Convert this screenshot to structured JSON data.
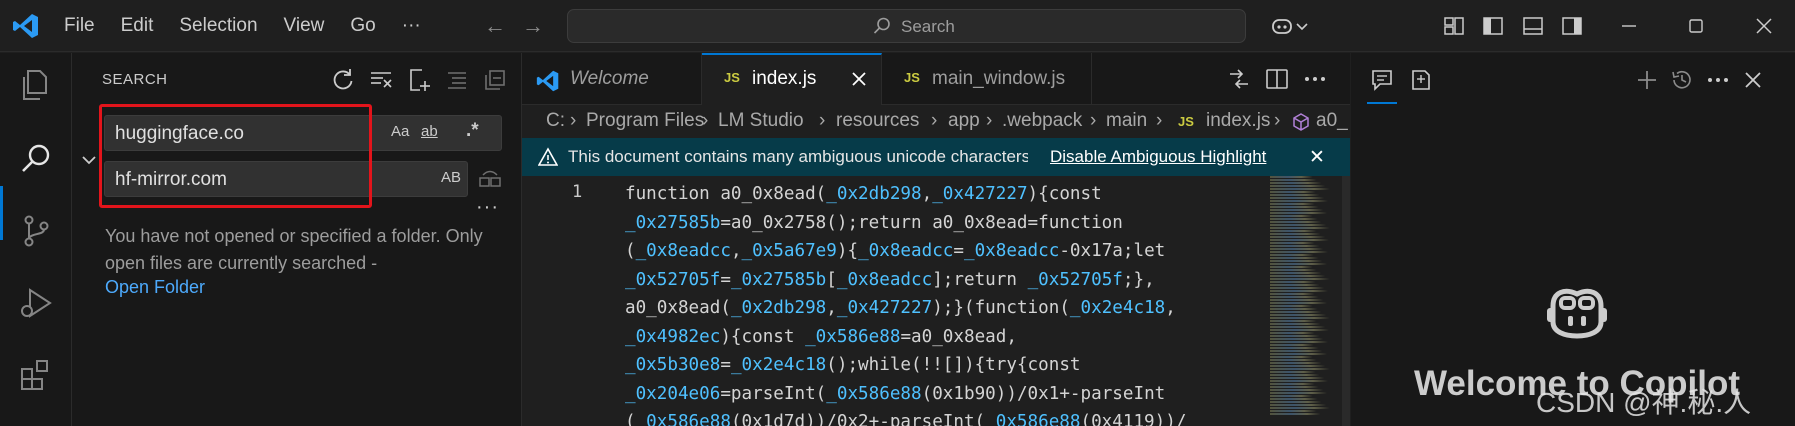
{
  "titlebar": {
    "menu": [
      "File",
      "Edit",
      "Selection",
      "View",
      "Go",
      "···"
    ],
    "search_placeholder": "Search"
  },
  "search_panel": {
    "title": "SEARCH",
    "search_value": "huggingface.co",
    "replace_value": "hf-mirror.com",
    "match_case": "Aa",
    "whole_word": "ab",
    "regex": ".*",
    "preserve_case": "AB",
    "more": "···",
    "message": "You have not opened or specified a folder. Only open files are currently searched -",
    "open_folder_link": "Open Folder"
  },
  "tabs": [
    {
      "label": "Welcome",
      "icon": "vscode-icon",
      "active": false
    },
    {
      "label": "index.js",
      "icon": "JS",
      "active": true
    },
    {
      "label": "main_window.js",
      "icon": "JS",
      "active": false
    }
  ],
  "breadcrumb": [
    "C:",
    "Program Files",
    "LM Studio",
    "resources",
    "app",
    ".webpack",
    "main",
    "index.js",
    "a0_"
  ],
  "banner": {
    "text": "This document contains many ambiguous unicode characters",
    "link": "Disable Ambiguous Highlight"
  },
  "editor": {
    "line_number": "1",
    "lines": [
      [
        [
          "function a0_0x8ead(",
          ""
        ],
        [
          "_0x2db298",
          "v"
        ],
        [
          ",",
          ""
        ],
        [
          "_0x427227",
          "v"
        ],
        [
          "){const",
          ""
        ]
      ],
      [
        [
          "_0x27585b",
          "v"
        ],
        [
          "=a0_0x2758();return a0_0x8ead=function",
          ""
        ]
      ],
      [
        [
          "(",
          ""
        ],
        [
          "_0x8eadcc",
          "v"
        ],
        [
          ",",
          ""
        ],
        [
          "_0x5a67e9",
          "v"
        ],
        [
          "){",
          ""
        ],
        [
          "_0x8eadcc",
          "v"
        ],
        [
          "=",
          ""
        ],
        [
          "_0x8eadcc",
          "v"
        ],
        [
          "-0x17a;let",
          ""
        ]
      ],
      [
        [
          "_0x52705f",
          "v"
        ],
        [
          "=",
          ""
        ],
        [
          "_0x27585b",
          "v"
        ],
        [
          "[",
          ""
        ],
        [
          "_0x8eadcc",
          "v"
        ],
        [
          "];return ",
          ""
        ],
        [
          "_0x52705f",
          "v"
        ],
        [
          ";},",
          ""
        ]
      ],
      [
        [
          "a0_0x8ead(",
          ""
        ],
        [
          "_0x2db298",
          "v"
        ],
        [
          ",",
          ""
        ],
        [
          "_0x427227",
          "v"
        ],
        [
          ");}(function(",
          ""
        ],
        [
          "_0x2e4c18",
          "v"
        ],
        [
          ",",
          ""
        ]
      ],
      [
        [
          "_0x4982ec",
          "v"
        ],
        [
          "){const ",
          ""
        ],
        [
          "_0x586e88",
          "v"
        ],
        [
          "=a0_0x8ead,",
          ""
        ]
      ],
      [
        [
          "_0x5b30e8",
          "v"
        ],
        [
          "=",
          ""
        ],
        [
          "_0x2e4c18",
          "v"
        ],
        [
          "();while(!![]){try{const",
          ""
        ]
      ],
      [
        [
          "_0x204e06",
          "v"
        ],
        [
          "=parseInt(",
          ""
        ],
        [
          "_0x586e88",
          "v"
        ],
        [
          "(0x1b90))/0x1+-parseInt",
          ""
        ]
      ],
      [
        [
          "(",
          ""
        ],
        [
          "_0x586e88",
          "v"
        ],
        [
          "(0x1d7d))/0x2+-parseInt(",
          ""
        ],
        [
          "_0x586e88",
          "v"
        ],
        [
          "(0x4119))/",
          ""
        ]
      ]
    ]
  },
  "copilot": {
    "welcome": "Welcome to Copilot"
  },
  "watermark": "CSDN @神.秘.人",
  "colors": {
    "accent": "#0078d4",
    "highlight_box": "#e3141b",
    "variable": "#4fc1ff",
    "link": "#4daafc",
    "banner_bg": "#063b49"
  }
}
